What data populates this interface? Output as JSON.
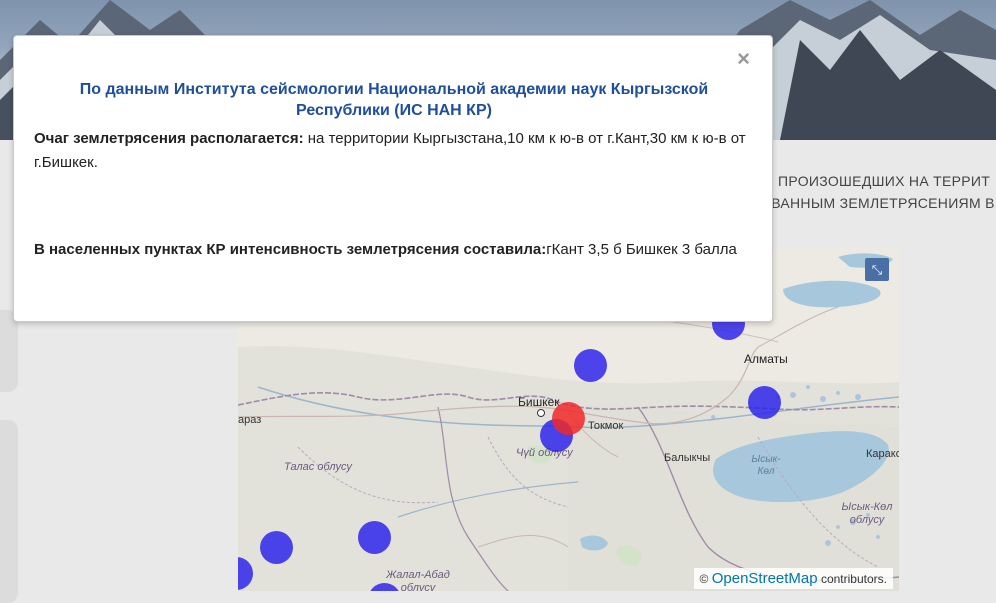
{
  "modal": {
    "title": "По данным Института сейсмологии Национальной академии наук Кыргызской Республики (ИС НАН КР)",
    "location_label": "Очаг землетрясения располагается:",
    "location_value": " на территории Кыргызстана,10 км к ю-в от г.Кант,30 км к ю-в от г.Бишкек.",
    "intensity_label": "В населенных пунктах КР интенсивность землетрясения составила:",
    "intensity_value": "гКант 3,5 б Бишкек 3 балла",
    "close_symbol": "×"
  },
  "page": {
    "section_line1": "Х, ПРОИЗОШЕДШИХ НА ТЕРРИТ",
    "section_line2": "ОВАННЫМ ЗЕМЛЕТРЯСЕНИЯМ В"
  },
  "map": {
    "labels": {
      "almaty": "Алматы",
      "bishkek": "Бишкек",
      "tokmok": "Токмок",
      "balykchy": "Балыкчы",
      "karakol": "Каракол",
      "taraz": "араз",
      "talas_region": "Талас облусу",
      "chui_region": "Чүй облусу",
      "issyk_kul_region": "Ысык-Көл облусу",
      "jalal_abad_region": "Жалал-Абад облусу",
      "issyk_kul_lake": "Ысык-Көл"
    },
    "attribution_prefix": "©",
    "attribution_link": "OpenStreetMap",
    "attribution_suffix": " contributors.",
    "expand_icon_symbol": "⤡",
    "marker_colors": {
      "historic": "#2a1eeb",
      "current": "#f02828"
    }
  }
}
